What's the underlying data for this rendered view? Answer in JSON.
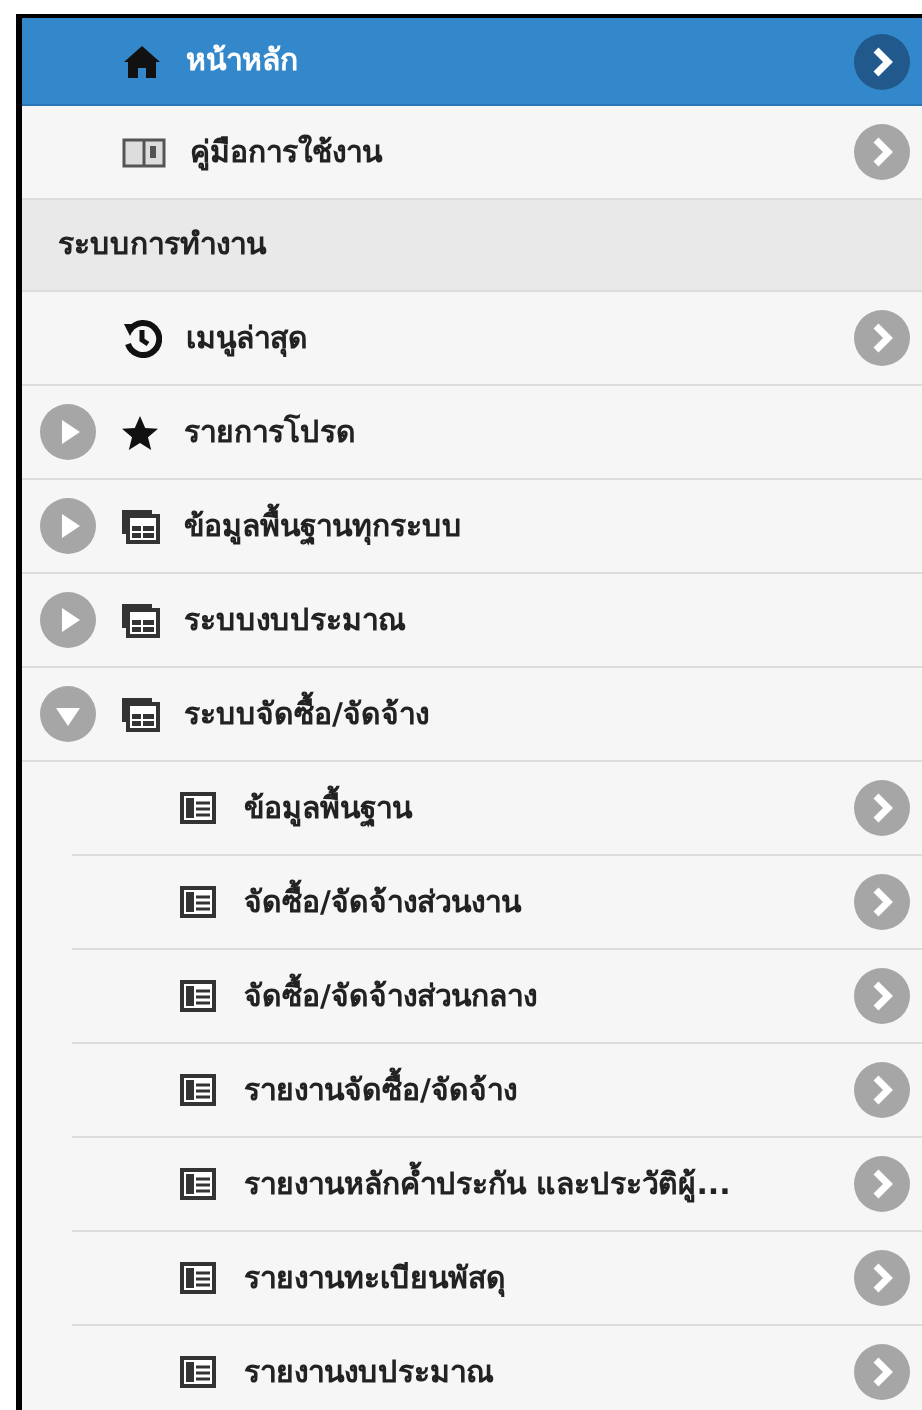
{
  "menu": [
    {
      "kind": "link",
      "label": "หน้าหลัก",
      "selected": true
    },
    {
      "kind": "link",
      "label": "คู่มือการใช้งาน",
      "selected": false
    },
    {
      "kind": "header",
      "label": "ระบบการทำงาน"
    },
    {
      "kind": "link",
      "label": "เมนูล่าสุด",
      "selected": false
    },
    {
      "kind": "group",
      "label": "รายการโปรด",
      "expanded": false
    },
    {
      "kind": "group",
      "label": "ข้อมูลพื้นฐานทุกระบบ",
      "expanded": false
    },
    {
      "kind": "group",
      "label": "ระบบงบประมาณ",
      "expanded": false
    },
    {
      "kind": "group",
      "label": "ระบบจัดซื้อ/จัดจ้าง",
      "expanded": true,
      "children": [
        {
          "label": "ข้อมูลพื้นฐาน",
          "selected": false
        },
        {
          "label": "จัดซื้อ/จัดจ้างส่วนงาน",
          "selected": false
        },
        {
          "label": "จัดซื้อ/จัดจ้างส่วนกลาง",
          "selected": false
        },
        {
          "label": "รายงานจัดซื้อ/จัดจ้าง",
          "selected": false
        },
        {
          "label": "รายงานหลักค้ำประกัน และประวัติผู้...",
          "selected": false
        },
        {
          "label": "รายงานทะเบียนพัสดุ",
          "selected": false
        },
        {
          "label": "รายงานงบประมาณ",
          "selected": false
        }
      ]
    }
  ]
}
